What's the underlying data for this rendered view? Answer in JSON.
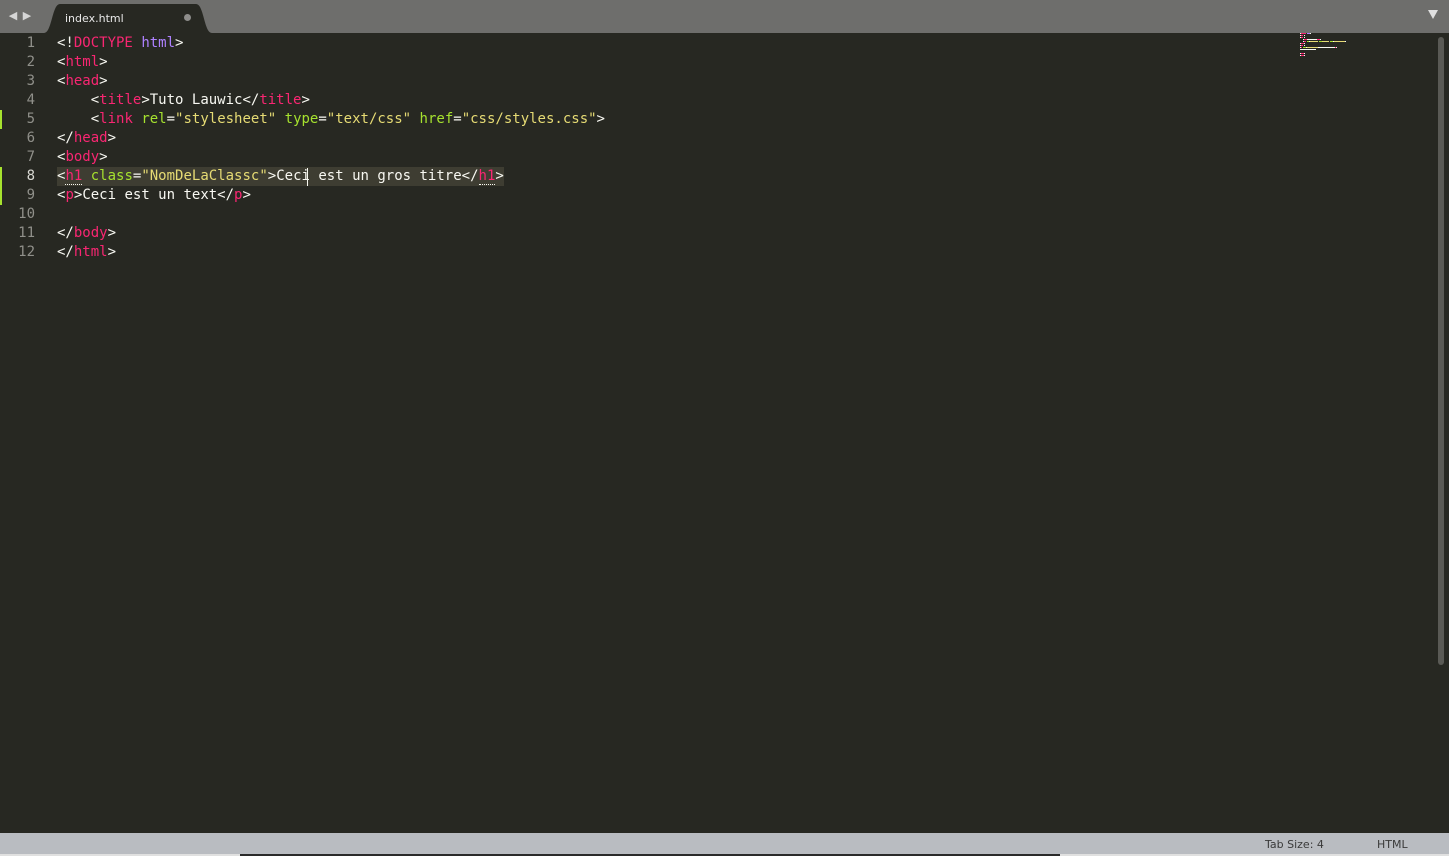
{
  "tab": {
    "filename": "index.html",
    "modified": true
  },
  "nav": {
    "back_icon": "triangle-left-icon",
    "forward_icon": "triangle-right-icon",
    "dropdown_icon": "triangle-down-icon"
  },
  "editor": {
    "current_line": 8,
    "modified_lines": [
      5,
      8,
      9
    ],
    "lines": [
      {
        "num": "1",
        "tokens": [
          [
            "p",
            "<!"
          ],
          [
            "dk",
            "DOCTYPE"
          ],
          [
            "x",
            " "
          ],
          [
            "dv",
            "html"
          ],
          [
            "p",
            ">"
          ]
        ]
      },
      {
        "num": "2",
        "tokens": [
          [
            "p",
            "<"
          ],
          [
            "t",
            "html"
          ],
          [
            "p",
            ">"
          ]
        ]
      },
      {
        "num": "3",
        "tokens": [
          [
            "p",
            "<"
          ],
          [
            "t",
            "head"
          ],
          [
            "p",
            ">"
          ]
        ]
      },
      {
        "num": "4",
        "tokens": [
          [
            "x",
            "    "
          ],
          [
            "p",
            "<"
          ],
          [
            "t",
            "title"
          ],
          [
            "p",
            ">"
          ],
          [
            "x",
            "Tuto Lauwic"
          ],
          [
            "p",
            "</"
          ],
          [
            "t",
            "title"
          ],
          [
            "p",
            ">"
          ]
        ]
      },
      {
        "num": "5",
        "tokens": [
          [
            "x",
            "    "
          ],
          [
            "p",
            "<"
          ],
          [
            "t",
            "link"
          ],
          [
            "x",
            " "
          ],
          [
            "a",
            "rel"
          ],
          [
            "p",
            "="
          ],
          [
            "s",
            "\"stylesheet\""
          ],
          [
            "x",
            " "
          ],
          [
            "a",
            "type"
          ],
          [
            "p",
            "="
          ],
          [
            "s",
            "\"text/css\""
          ],
          [
            "x",
            " "
          ],
          [
            "a",
            "href"
          ],
          [
            "p",
            "="
          ],
          [
            "s",
            "\"css/styles.css\""
          ],
          [
            "p",
            ">"
          ]
        ]
      },
      {
        "num": "6",
        "tokens": [
          [
            "p",
            "</"
          ],
          [
            "t",
            "head"
          ],
          [
            "p",
            ">"
          ]
        ]
      },
      {
        "num": "7",
        "tokens": [
          [
            "p",
            "<"
          ],
          [
            "t",
            "body"
          ],
          [
            "p",
            ">"
          ]
        ]
      },
      {
        "num": "8",
        "tokens": [
          [
            "p",
            "<"
          ],
          [
            "tm",
            "h1"
          ],
          [
            "x",
            " "
          ],
          [
            "a",
            "class"
          ],
          [
            "p",
            "="
          ],
          [
            "s",
            "\"NomDeLaClassc"
          ],
          [
            "s",
            "\""
          ],
          [
            "p",
            ">"
          ],
          [
            "x",
            "Ceci est un gros titre"
          ],
          [
            "p",
            "</"
          ],
          [
            "tm",
            "h1"
          ],
          [
            "p",
            ">"
          ]
        ]
      },
      {
        "num": "9",
        "tokens": [
          [
            "p",
            "<"
          ],
          [
            "t",
            "p"
          ],
          [
            "p",
            ">"
          ],
          [
            "x",
            "Ceci est un text"
          ],
          [
            "p",
            "</"
          ],
          [
            "t",
            "p"
          ],
          [
            "p",
            ">"
          ]
        ]
      },
      {
        "num": "10",
        "tokens": []
      },
      {
        "num": "11",
        "tokens": [
          [
            "p",
            "</"
          ],
          [
            "t",
            "body"
          ],
          [
            "p",
            ">"
          ]
        ]
      },
      {
        "num": "12",
        "tokens": [
          [
            "p",
            "</"
          ],
          [
            "t",
            "html"
          ],
          [
            "p",
            ">"
          ]
        ]
      }
    ]
  },
  "status": {
    "tab_size": "Tab Size: 4",
    "syntax": "HTML"
  },
  "colors": {
    "background": "#272822",
    "tag": "#f92672",
    "attribute": "#a6e22e",
    "string": "#e6db74",
    "text": "#f8f8f2",
    "doctype_value": "#ae81ff",
    "line_number": "#90908a",
    "modified_marker": "#a6e22e",
    "tabbar": "#6e6e6c",
    "statusbar": "#b9bcc1"
  }
}
